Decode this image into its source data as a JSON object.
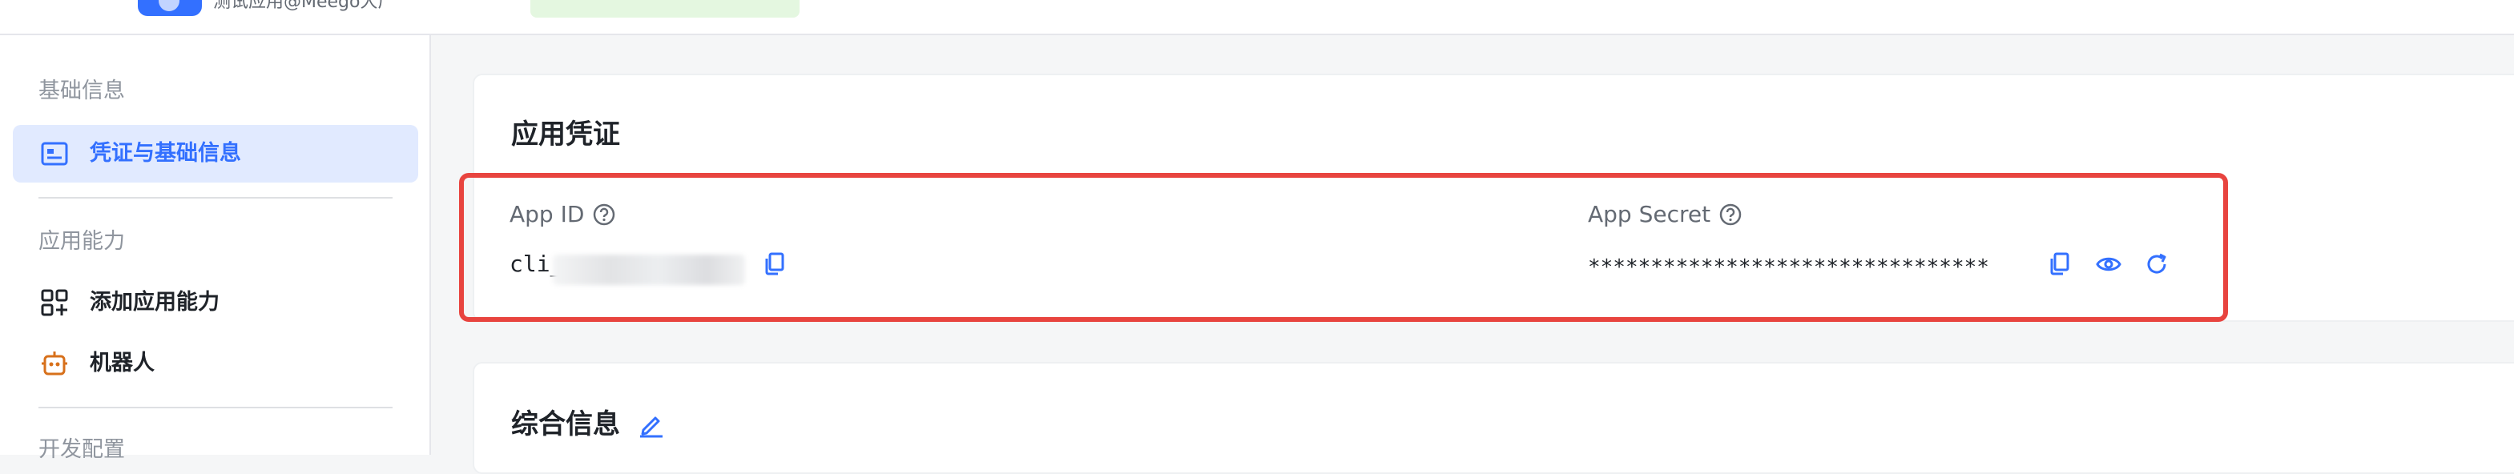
{
  "header": {
    "app_name": "测试应用@Meego大厂"
  },
  "sidebar": {
    "groups": [
      {
        "title": "基础信息",
        "items": [
          {
            "label": "凭证与基础信息",
            "icon": "credential-card-icon",
            "active": true
          }
        ]
      },
      {
        "title": "应用能力",
        "items": [
          {
            "label": "添加应用能力",
            "icon": "add-capability-icon",
            "active": false
          },
          {
            "label": "机器人",
            "icon": "robot-icon",
            "active": false
          }
        ]
      },
      {
        "title": "开发配置",
        "items": []
      }
    ]
  },
  "main": {
    "credentials": {
      "title": "应用凭证",
      "app_id": {
        "label": "App ID",
        "value": "cli_a"
      },
      "app_secret": {
        "label": "App Secret",
        "value": "********************************"
      }
    },
    "general_info": {
      "title": "综合信息"
    }
  },
  "colors": {
    "accent": "#3370ff",
    "active_bg": "#e1eaff",
    "highlight_border": "#e8443f",
    "robot_icon": "#d7701b"
  }
}
